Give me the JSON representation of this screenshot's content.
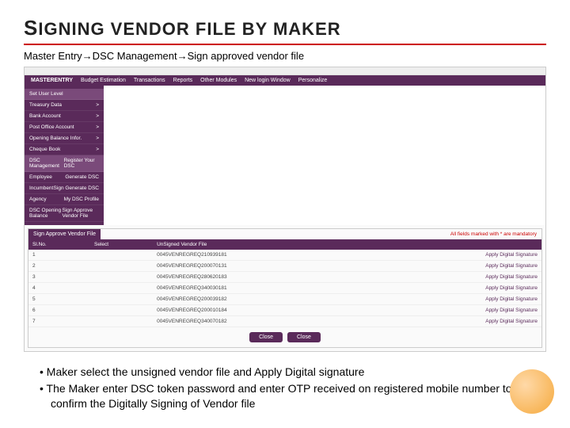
{
  "title": {
    "t1": "S",
    "t2": "IGNING VENDOR FILE BY MAKER"
  },
  "breadcrumb": "Master Entry→DSC Management→Sign approved vendor file",
  "nav": {
    "main": "MASTERENTRY",
    "items": [
      "Budget Estimation",
      "Transactions",
      "Reports",
      "Other Modules",
      "New login Window",
      "Personalize"
    ]
  },
  "sidebar": [
    {
      "label": "Set User Level"
    },
    {
      "label": "Treasury Data"
    },
    {
      "label": "Bank Account"
    },
    {
      "label": "Post Office Account"
    },
    {
      "label": "Opening Balance Infor."
    },
    {
      "label": "Cheque Book"
    },
    {
      "label": "DSC Management",
      "sub": "Register Your DSC"
    },
    {
      "label": "Employee",
      "sub": "Generate DSC"
    },
    {
      "label": "Incumbent",
      "sub": "Sign Generate DSC"
    },
    {
      "label": "Agency",
      "sub": "My DSC Profile"
    },
    {
      "label": "DSC Opening Balance",
      "sub": "Sign Approve Vendor File"
    }
  ],
  "panel": {
    "title": "Sign Approve Vendor File",
    "mandatory": "All fields marked with * are mandatory"
  },
  "columns": {
    "c1": "Sl.No.",
    "c2": "Select",
    "c3": "UnSigned Vendor File",
    "c4": ""
  },
  "rows": [
    {
      "n": "1",
      "file": "0045VENREGREQ210939181",
      "action": "Apply Digital Signature"
    },
    {
      "n": "2",
      "file": "0045VENREGREQ200070131",
      "action": "Apply Digital Signature"
    },
    {
      "n": "3",
      "file": "0045VENREGREQ280620183",
      "action": "Apply Digital Signature"
    },
    {
      "n": "4",
      "file": "0045VENREGREQ340030181",
      "action": "Apply Digital Signature"
    },
    {
      "n": "5",
      "file": "0045VENREGREQ200039182",
      "action": "Apply Digital Signature"
    },
    {
      "n": "6",
      "file": "0045VENREGREQ200010184",
      "action": "Apply Digital Signature"
    },
    {
      "n": "7",
      "file": "0045VENREGREQ340070182",
      "action": "Apply Digital Signature"
    }
  ],
  "buttons": {
    "b1": "Close",
    "b2": "Close"
  },
  "bullets": {
    "b1": "Maker select the unsigned vendor file and Apply Digital signature",
    "b2": "The Maker enter DSC token password and enter OTP received on registered mobile number to confirm the Digitally Signing of Vendor file"
  }
}
